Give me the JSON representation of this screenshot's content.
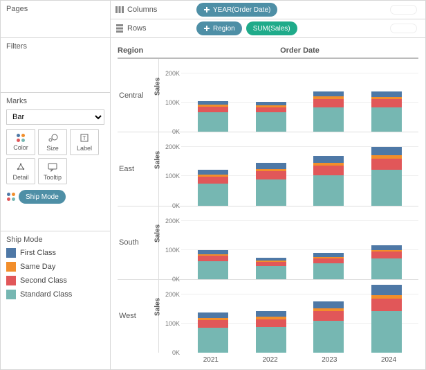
{
  "panels": {
    "pages": "Pages",
    "filters": "Filters",
    "marks": "Marks"
  },
  "marks": {
    "type_selected": "Bar",
    "buttons": {
      "color": "Color",
      "size": "Size",
      "label": "Label",
      "detail": "Detail",
      "tooltip": "Tooltip"
    },
    "color_shelf_pill": "Ship Mode"
  },
  "legend": {
    "title": "Ship Mode",
    "items": [
      {
        "label": "First Class",
        "color": "#4e78a6"
      },
      {
        "label": "Same Day",
        "color": "#f28e2b"
      },
      {
        "label": "Second Class",
        "color": "#e15759"
      },
      {
        "label": "Standard Class",
        "color": "#76b7b2"
      }
    ]
  },
  "shelves": {
    "columns_label": "Columns",
    "rows_label": "Rows",
    "columns_pills": [
      {
        "label": "YEAR(Order Date)",
        "kind": "dimension"
      }
    ],
    "rows_pills": [
      {
        "label": "Region",
        "kind": "dimension"
      },
      {
        "label": "SUM(Sales)",
        "kind": "measure"
      }
    ]
  },
  "viz_headers": {
    "region": "Region",
    "orderdate": "Order Date",
    "sales_axis": "Sales"
  },
  "yaxis": {
    "ticks": [
      "0K",
      "100K",
      "200K"
    ],
    "max": 250
  },
  "xaxis": [
    "2021",
    "2022",
    "2023",
    "2024"
  ],
  "chart_data": {
    "type": "bar",
    "stacked": true,
    "facet_rows": "Region",
    "facet_cols": "YEAR(Order Date)",
    "y": "SUM(Sales)",
    "ylim": [
      0,
      250000
    ],
    "yticks": [
      0,
      100000,
      200000
    ],
    "ylabel": "Sales",
    "categories": [
      "2021",
      "2022",
      "2023",
      "2024"
    ],
    "series_order": [
      "Standard Class",
      "Second Class",
      "Same Day",
      "First Class"
    ],
    "series_colors": {
      "First Class": "#4e78a6",
      "Same Day": "#f28e2b",
      "Second Class": "#e15759",
      "Standard Class": "#76b7b2"
    },
    "regions": [
      {
        "name": "Central",
        "bars": [
          {
            "year": "2021",
            "Standard Class": 70,
            "Second Class": 22,
            "Same Day": 6,
            "First Class": 14
          },
          {
            "year": "2022",
            "Standard Class": 70,
            "Second Class": 20,
            "Same Day": 6,
            "First Class": 14
          },
          {
            "year": "2023",
            "Standard Class": 90,
            "Second Class": 30,
            "Same Day": 8,
            "First Class": 20
          },
          {
            "year": "2024",
            "Standard Class": 90,
            "Second Class": 28,
            "Same Day": 8,
            "First Class": 22
          }
        ]
      },
      {
        "name": "East",
        "bars": [
          {
            "year": "2021",
            "Standard Class": 80,
            "Second Class": 25,
            "Same Day": 7,
            "First Class": 18
          },
          {
            "year": "2022",
            "Standard Class": 95,
            "Second Class": 30,
            "Same Day": 8,
            "First Class": 22
          },
          {
            "year": "2023",
            "Standard Class": 110,
            "Second Class": 35,
            "Same Day": 10,
            "First Class": 26
          },
          {
            "year": "2024",
            "Standard Class": 130,
            "Second Class": 40,
            "Same Day": 12,
            "First Class": 30
          }
        ]
      },
      {
        "name": "South",
        "bars": [
          {
            "year": "2021",
            "Standard Class": 65,
            "Second Class": 20,
            "Same Day": 5,
            "First Class": 15
          },
          {
            "year": "2022",
            "Standard Class": 48,
            "Second Class": 15,
            "Same Day": 4,
            "First Class": 10
          },
          {
            "year": "2023",
            "Standard Class": 58,
            "Second Class": 18,
            "Same Day": 5,
            "First Class": 13
          },
          {
            "year": "2024",
            "Standard Class": 75,
            "Second Class": 24,
            "Same Day": 7,
            "First Class": 18
          }
        ]
      },
      {
        "name": "West",
        "bars": [
          {
            "year": "2021",
            "Standard Class": 90,
            "Second Class": 28,
            "Same Day": 8,
            "First Class": 20
          },
          {
            "year": "2022",
            "Standard Class": 92,
            "Second Class": 30,
            "Same Day": 8,
            "First Class": 22
          },
          {
            "year": "2023",
            "Standard Class": 115,
            "Second Class": 36,
            "Same Day": 10,
            "First Class": 26
          },
          {
            "year": "2024",
            "Standard Class": 150,
            "Second Class": 46,
            "Same Day": 14,
            "First Class": 36
          }
        ]
      }
    ]
  }
}
